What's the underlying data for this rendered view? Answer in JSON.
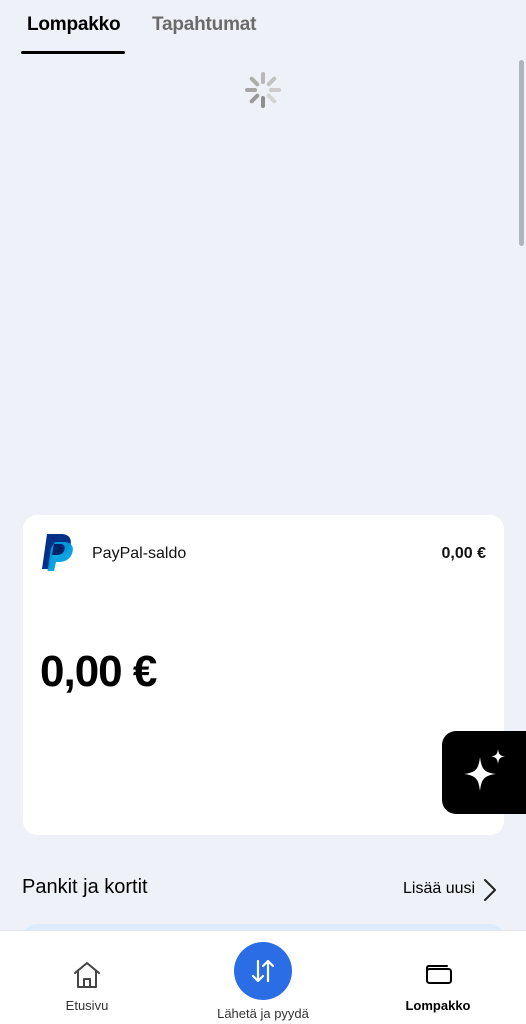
{
  "tabs": {
    "active": "Lompakko",
    "inactive": "Tapahtumat"
  },
  "balance_card": {
    "label": "PayPal-saldo",
    "amount_small": "0,00 €",
    "amount_big": "0,00 €",
    "logo": "paypal-logo"
  },
  "floating_button": {
    "icon": "sparkle-icon"
  },
  "banks_section": {
    "title": "Pankit ja kortit",
    "add_new": "Lisää uusi"
  },
  "bottom_nav": {
    "home": {
      "label": "Etusivu",
      "icon": "home-icon"
    },
    "send": {
      "label": "Lähetä ja pyydä",
      "icon": "transfer-arrows-icon"
    },
    "wallet": {
      "label": "Lompakko",
      "icon": "wallet-icon"
    }
  },
  "colors": {
    "background": "#eef1f8",
    "accent": "#2a6de4",
    "paypal_dark": "#003087",
    "paypal_light": "#009cde"
  }
}
